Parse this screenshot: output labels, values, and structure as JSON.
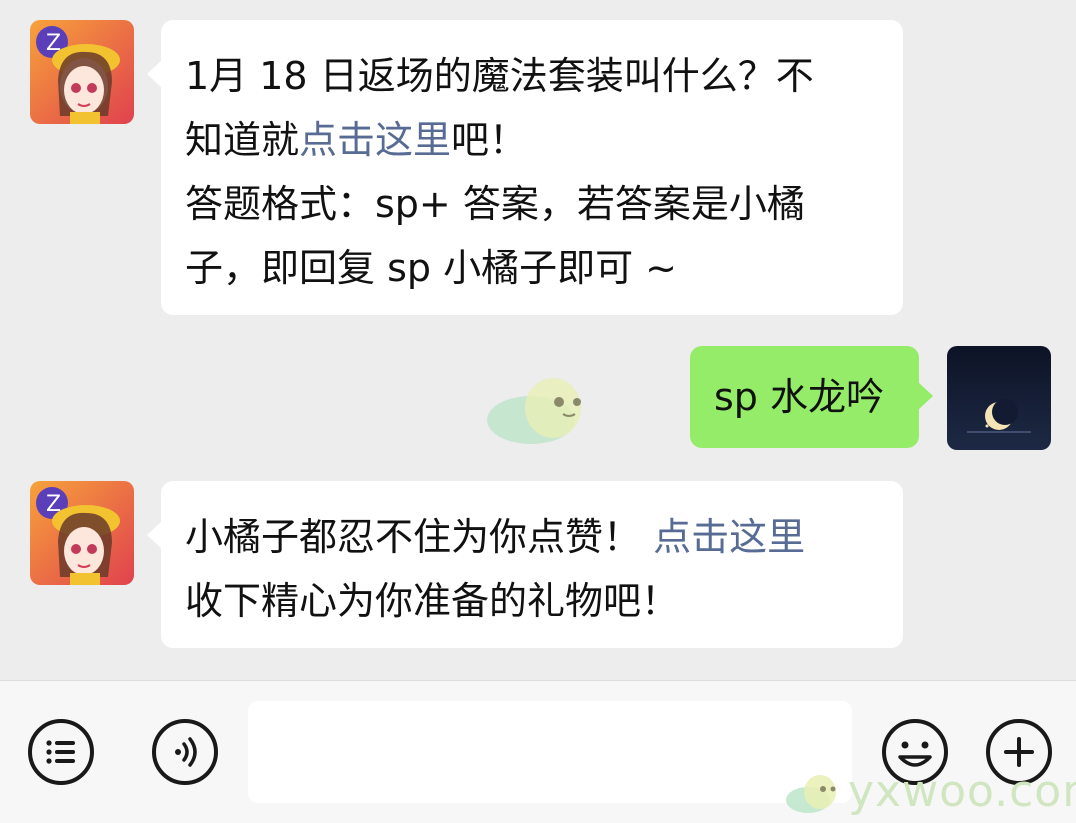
{
  "messages": [
    {
      "sender": "official-account",
      "avatar_icon": "game-character-avatar",
      "line1": "1月 18 日返场的魔法套装叫什么？不",
      "line2_pre": "知道就",
      "line2_link": "点击这里",
      "line2_post": "吧！",
      "line3": "答题格式：sp+ 答案，若答案是小橘",
      "line4": "子，即回复 sp 小橘子即可 ~"
    },
    {
      "sender": "user",
      "avatar_icon": "crescent-moon-avatar",
      "text": "sp 水龙吟"
    },
    {
      "sender": "official-account",
      "avatar_icon": "game-character-avatar",
      "line1_pre": "小橘子都忍不住为你点赞！",
      "line1_link": "点击这里",
      "line2": "收下精心为你准备的礼物吧！"
    }
  ],
  "bottom_bar": {
    "menu_icon": "menu-list-icon",
    "voice_icon": "voice-icon",
    "emoji_icon": "emoji-icon",
    "plus_icon": "plus-icon"
  },
  "watermark": {
    "text": "yxwoo.com"
  },
  "colors": {
    "background": "#ededed",
    "bubble_white": "#ffffff",
    "bubble_green": "#95ec69",
    "link": "#576b95"
  }
}
